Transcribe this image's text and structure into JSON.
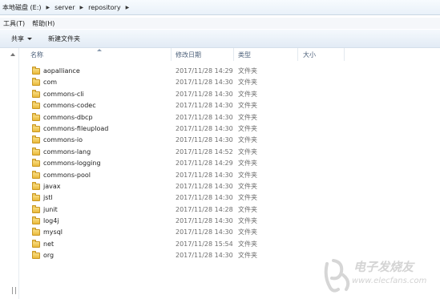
{
  "breadcrumb": [
    "本地磁盘 (E:)",
    "server",
    "repository"
  ],
  "menu": [
    "工具(T)",
    "帮助(H)"
  ],
  "toolbar": {
    "share_label": "共享",
    "new_folder_label": "新建文件夹"
  },
  "columns": {
    "name": "名称",
    "date": "修改日期",
    "type": "类型",
    "size": "大小"
  },
  "rows": [
    {
      "name": "aopalliance",
      "date": "2017/11/28 14:29",
      "type": "文件夹"
    },
    {
      "name": "com",
      "date": "2017/11/28 14:30",
      "type": "文件夹"
    },
    {
      "name": "commons-cli",
      "date": "2017/11/28 14:30",
      "type": "文件夹"
    },
    {
      "name": "commons-codec",
      "date": "2017/11/28 14:30",
      "type": "文件夹"
    },
    {
      "name": "commons-dbcp",
      "date": "2017/11/28 14:30",
      "type": "文件夹"
    },
    {
      "name": "commons-fileupload",
      "date": "2017/11/28 14:30",
      "type": "文件夹"
    },
    {
      "name": "commons-io",
      "date": "2017/11/28 14:30",
      "type": "文件夹"
    },
    {
      "name": "commons-lang",
      "date": "2017/11/28 14:52",
      "type": "文件夹"
    },
    {
      "name": "commons-logging",
      "date": "2017/11/28 14:29",
      "type": "文件夹"
    },
    {
      "name": "commons-pool",
      "date": "2017/11/28 14:30",
      "type": "文件夹"
    },
    {
      "name": "javax",
      "date": "2017/11/28 14:30",
      "type": "文件夹"
    },
    {
      "name": "jstl",
      "date": "2017/11/28 14:30",
      "type": "文件夹"
    },
    {
      "name": "junit",
      "date": "2017/11/28 14:28",
      "type": "文件夹"
    },
    {
      "name": "log4j",
      "date": "2017/11/28 14:30",
      "type": "文件夹"
    },
    {
      "name": "mysql",
      "date": "2017/11/28 14:30",
      "type": "文件夹"
    },
    {
      "name": "net",
      "date": "2017/11/28 15:54",
      "type": "文件夹"
    },
    {
      "name": "org",
      "date": "2017/11/28 14:30",
      "type": "文件夹"
    }
  ],
  "icons": {
    "folder": "folder-icon",
    "watermark_logo": "elecfans-logo-icon"
  },
  "watermark": {
    "text": "电子发烧友",
    "url": "www.elecfans.com"
  }
}
